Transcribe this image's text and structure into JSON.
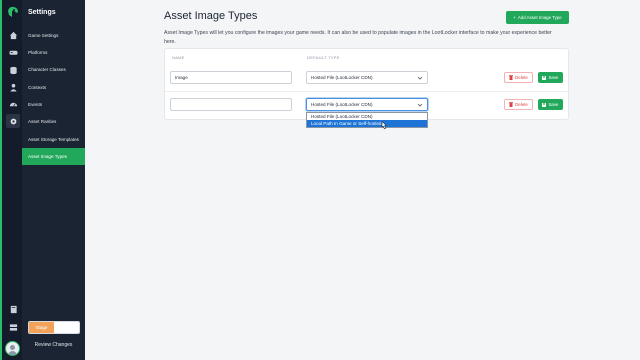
{
  "app": {
    "settings_title": "Settings",
    "stage_label": "Stage",
    "review_changes": "Review Changes"
  },
  "rail_icons": [
    "home-icon",
    "gamepad-icon",
    "database-icon",
    "player-icon",
    "gauge-icon",
    "settings-icon",
    "book-icon",
    "server-icon"
  ],
  "sidebar": {
    "items": [
      {
        "label": "Game Settings"
      },
      {
        "label": "Platforms"
      },
      {
        "label": "Character Classes"
      },
      {
        "label": "Contexts"
      },
      {
        "label": "Events"
      },
      {
        "label": "Asset Rarities"
      },
      {
        "label": "Asset Storage Templates"
      },
      {
        "label": "Asset Image Types",
        "active": true
      }
    ]
  },
  "page": {
    "title": "Asset Image Types",
    "add_button": "Add Asset Image Type",
    "description": "Asset Image Types will let you configure the images your game needs. It can also be used to populate images in the LootLocker interface to make your experience better here."
  },
  "table": {
    "headers": {
      "name": "NAME",
      "default_type": "DEFAULT TYPE"
    },
    "rows": [
      {
        "name": "Image",
        "default_type": "Hosted File (LootLocker CDN)",
        "delete_label": "Delete",
        "save_label": "Save"
      },
      {
        "name": "",
        "default_type": "Hosted File (LootLocker CDN)",
        "delete_label": "Delete",
        "save_label": "Save"
      }
    ]
  },
  "dropdown": {
    "options": [
      "Hosted File (LootLocker CDN)",
      "Local Path In Game or Self-hosted"
    ],
    "highlighted_index": 1
  },
  "colors": {
    "accent": "#22a85a",
    "sidebar_bg": "#1b2433",
    "rail_bg": "#141c2b",
    "stage": "#f3a25a",
    "danger": "#dd4444",
    "highlight": "#1e74d6"
  }
}
